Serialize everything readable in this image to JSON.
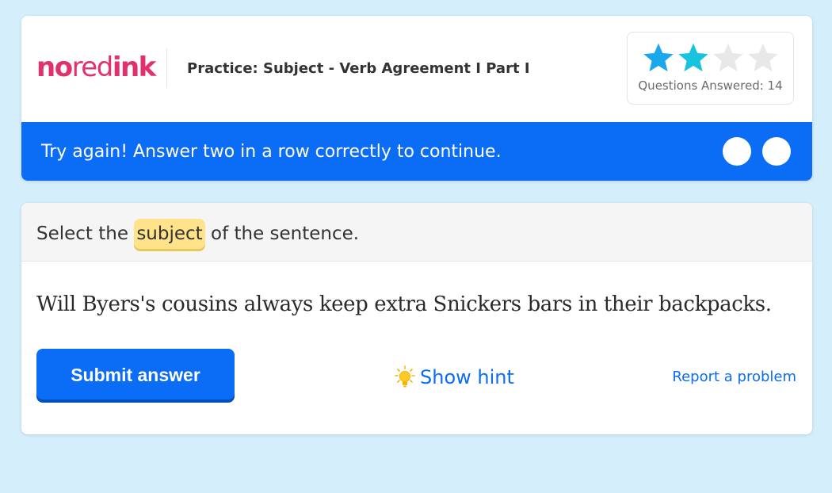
{
  "header": {
    "logo": {
      "part1": "no",
      "part2": "red",
      "part3": "ink"
    },
    "practice_title": "Practice: Subject - Verb Agreement I Part I",
    "progress": {
      "stars_filled": 2,
      "stars_total": 4,
      "answered_label": "Questions Answered: 14"
    }
  },
  "banner": {
    "message": "Try again! Answer two in a row correctly to continue.",
    "indicators": 2
  },
  "question": {
    "prompt_before": "Select the ",
    "prompt_highlight": "subject",
    "prompt_after": " of the sentence.",
    "sentence": "Will Byers's cousins always keep extra Snickers bars in their backpacks."
  },
  "actions": {
    "submit_label": "Submit answer",
    "hint_label": "Show hint",
    "report_label": "Report a problem"
  },
  "colors": {
    "brand_pink": "#e2306c",
    "accent_blue": "#0b6cf5",
    "star_filled": "#1aa7ec",
    "star_empty": "#e6e6e6",
    "highlight": "#ffe38a",
    "background": "#d4eefc"
  }
}
